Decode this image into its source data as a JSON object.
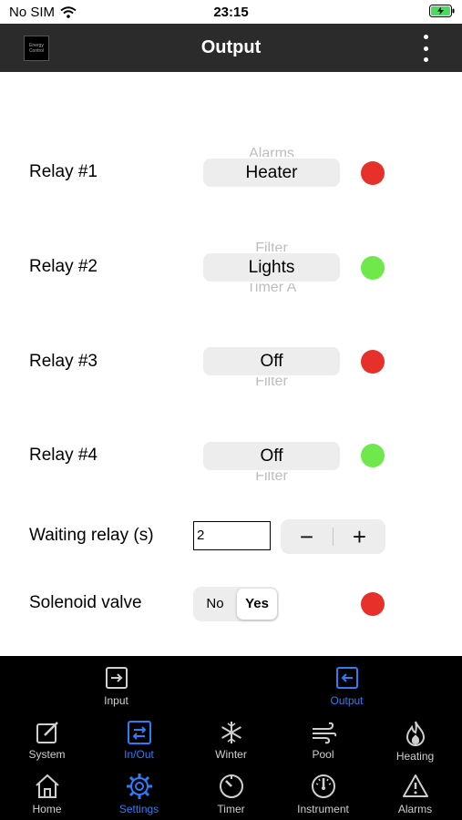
{
  "status": {
    "carrier": "No SIM",
    "time": "23:15"
  },
  "header": {
    "title": "Output",
    "logo_text": "Energy Control"
  },
  "relays": [
    {
      "label": "Relay #1",
      "above": "Alarms",
      "selected": "Heater",
      "below": "",
      "color": "#e8302a"
    },
    {
      "label": "Relay #2",
      "above": "Filter",
      "selected": "Lights",
      "below": "Timer A",
      "color": "#6ee84a"
    },
    {
      "label": "Relay #3",
      "above": "",
      "selected": "Off",
      "below": "Filter",
      "color": "#e8302a"
    },
    {
      "label": "Relay #4",
      "above": "",
      "selected": "Off",
      "below": "Filter",
      "color": "#6ee84a"
    }
  ],
  "waiting": {
    "label": "Waiting relay (s)",
    "value": "2",
    "minus": "−",
    "plus": "+"
  },
  "solenoid": {
    "label": "Solenoid valve",
    "no": "No",
    "yes": "Yes",
    "color": "#e8302a"
  },
  "subtabs": [
    {
      "label": "Input",
      "icon": "input-arrow-icon",
      "active": false
    },
    {
      "label": "Output",
      "icon": "output-arrow-icon",
      "active": true
    }
  ],
  "tabs_row1": [
    {
      "label": "System",
      "icon": "edit-icon",
      "active": false
    },
    {
      "label": "In/Out",
      "icon": "swap-arrows-icon",
      "active": true
    },
    {
      "label": "Winter",
      "icon": "snowflake-icon",
      "active": false
    },
    {
      "label": "Pool",
      "icon": "wind-icon",
      "active": false
    },
    {
      "label": "Heating",
      "icon": "flame-icon",
      "active": false
    }
  ],
  "tabs_row2": [
    {
      "label": "Home",
      "icon": "home-icon",
      "active": false
    },
    {
      "label": "Settings",
      "icon": "gear-icon",
      "active": true
    },
    {
      "label": "Timer",
      "icon": "timer-icon",
      "active": false
    },
    {
      "label": "Instrument",
      "icon": "gauge-icon",
      "active": false
    },
    {
      "label": "Alarms",
      "icon": "warning-icon",
      "active": false
    }
  ],
  "colors": {
    "accent": "#2f7df6",
    "red": "#e8302a",
    "green": "#6ee84a",
    "nav": "#2b2b2b"
  }
}
